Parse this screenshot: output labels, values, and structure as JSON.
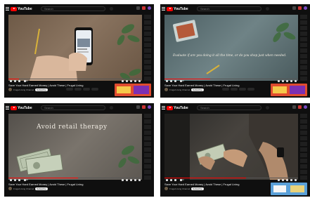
{
  "app": {
    "logo_text": "YouTube"
  },
  "search": {
    "placeholder": "Search"
  },
  "video": {
    "title": "Save Your Hard Earned Money | Avoid These | Frugal Living",
    "channel": "Frugal Living Channel",
    "subscribe_label": "Subscribe",
    "time": "0:42 / 8:15"
  },
  "frames": [
    {
      "caption": "",
      "progress": 0.08,
      "time": "0:42"
    },
    {
      "caption": "Evaluate if are you doing it all the time, or do you shop just when needed.",
      "progress": 0.34,
      "time": "2:48"
    },
    {
      "caption": "Avoid retail therapy",
      "progress": 0.52,
      "time": "4:18"
    },
    {
      "caption": "",
      "progress": 0.61,
      "time": "5:02"
    }
  ],
  "colors": {
    "accent": "#ff0000",
    "background": "#0f0f0f"
  }
}
